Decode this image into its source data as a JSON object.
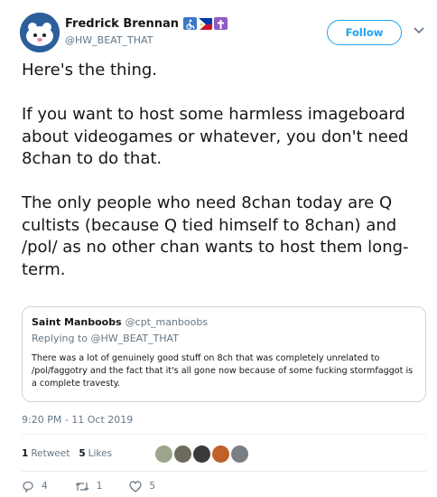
{
  "author": {
    "display_name": "Fredrick Brennan",
    "handle": "@HW_BEAT_THAT",
    "emojis": [
      "wheelchair-symbol-icon",
      "philippines-flag-icon",
      "latin-cross-icon"
    ]
  },
  "follow_label": "Follow",
  "tweet": {
    "paragraphs": [
      "Here's the thing.",
      "If you want to host some harmless imageboard about videogames or whatever, you don't need 8chan to do that.",
      "The only people who need 8chan today are Q cultists (because Q tied himself to 8chan) and /pol/ as no other chan wants to host them long-term."
    ]
  },
  "quoted": {
    "display_name": "Saint Manboobs",
    "handle": "@cpt_manboobs",
    "replying_to": "Replying to @HW_BEAT_THAT",
    "text": "There was a lot of genuinely good stuff on 8ch that was completely unrelated to /pol/faggotry and the fact that it's all gone now because of some fucking stormfaggot is a complete travesty."
  },
  "timestamp": "9:20 PM - 11 Oct 2019",
  "stats": {
    "retweets_count": "1",
    "retweets_label": "Retweet",
    "likes_count": "5",
    "likes_label": "Likes"
  },
  "likers": [
    "#9aa58c",
    "#6e6a5e",
    "#3a3a3a",
    "#c0602a",
    "#7a7f84"
  ],
  "actions": {
    "replies": "4",
    "retweets": "1",
    "likes": "5"
  },
  "colors": {
    "accent": "#1da1f2",
    "secondary_text": "#657786",
    "border": "#ccd6dd"
  }
}
